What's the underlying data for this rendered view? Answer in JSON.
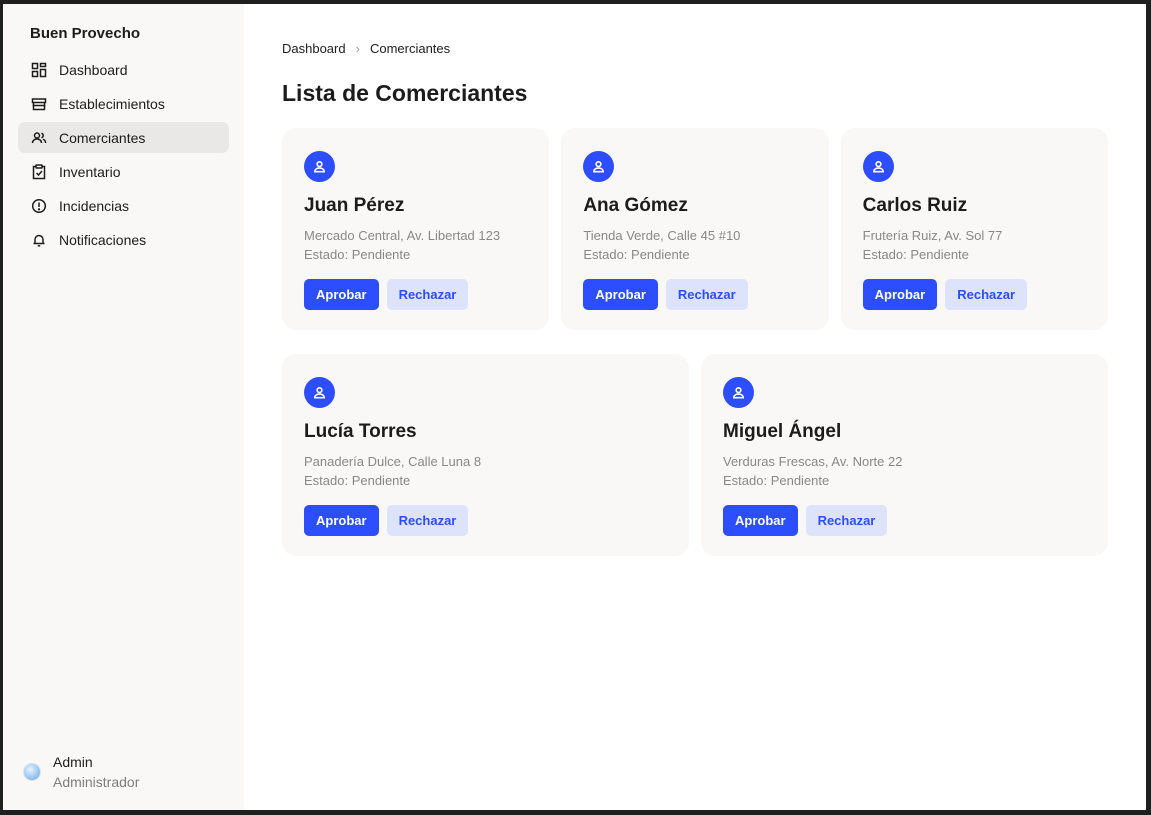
{
  "app": {
    "brand": "Buen Provecho"
  },
  "sidebar": {
    "items": [
      {
        "label": "Dashboard",
        "icon": "dashboard-icon",
        "active": false
      },
      {
        "label": "Establecimientos",
        "icon": "store-icon",
        "active": false
      },
      {
        "label": "Comerciantes",
        "icon": "users-icon",
        "active": true
      },
      {
        "label": "Inventario",
        "icon": "clipboard-check-icon",
        "active": false
      },
      {
        "label": "Incidencias",
        "icon": "alert-circle-icon",
        "active": false
      },
      {
        "label": "Notificaciones",
        "icon": "bell-icon",
        "active": false
      }
    ]
  },
  "user": {
    "name": "Admin",
    "role": "Administrador"
  },
  "breadcrumb": {
    "root": "Dashboard",
    "current": "Comerciantes"
  },
  "page": {
    "title": "Lista de Comerciantes"
  },
  "actions": {
    "approve": "Aprobar",
    "reject": "Rechazar"
  },
  "merchants": [
    {
      "name": "Juan Pérez",
      "address": "Mercado Central, Av. Libertad 123",
      "status": "Estado: Pendiente"
    },
    {
      "name": "Ana Gómez",
      "address": "Tienda Verde, Calle 45 #10",
      "status": "Estado: Pendiente"
    },
    {
      "name": "Carlos Ruiz",
      "address": "Frutería Ruiz, Av. Sol 77",
      "status": "Estado: Pendiente"
    },
    {
      "name": "Lucía Torres",
      "address": "Panadería Dulce, Calle Luna 8",
      "status": "Estado: Pendiente"
    },
    {
      "name": "Miguel Ángel",
      "address": "Verduras Frescas, Av. Norte 22",
      "status": "Estado: Pendiente"
    }
  ],
  "colors": {
    "accent": "#2d4eff",
    "accent_soft": "#dde3fb",
    "card_bg": "#f9f8f6",
    "sidebar_bg": "#f9f8f6"
  }
}
